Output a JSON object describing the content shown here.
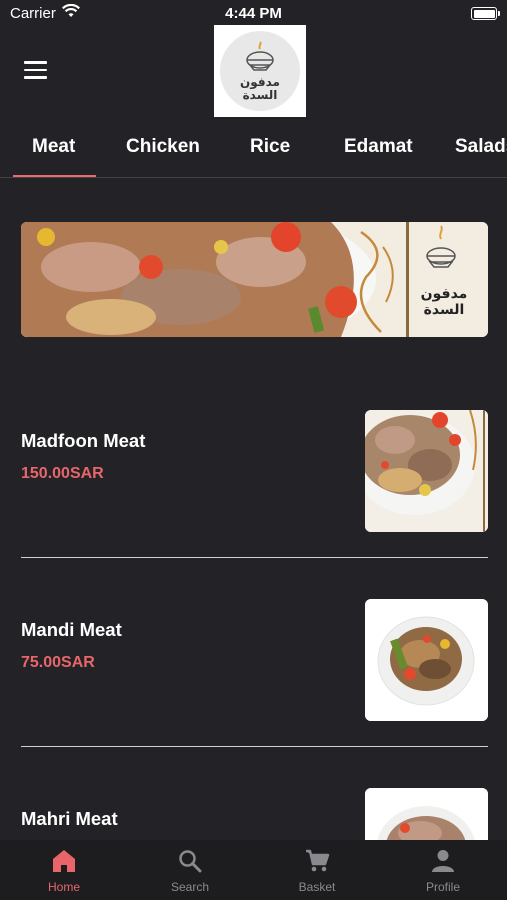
{
  "status_bar": {
    "carrier": "Carrier",
    "time": "4:44 PM"
  },
  "header": {
    "logo_text_line1": "مدفون",
    "logo_text_line2": "السدة"
  },
  "tabs": [
    {
      "label": "Meat",
      "active": true
    },
    {
      "label": "Chicken"
    },
    {
      "label": "Rice"
    },
    {
      "label": "Edamat"
    },
    {
      "label": "Salads"
    }
  ],
  "banner": {
    "logo_text_line1": "مدفون",
    "logo_text_line2": "السدة"
  },
  "items": [
    {
      "name": "Madfoon Meat",
      "price": "150.00SAR"
    },
    {
      "name": "Mandi Meat",
      "price": "75.00SAR"
    },
    {
      "name": "Mahri Meat",
      "price": ""
    }
  ],
  "bottom_nav": [
    {
      "label": "Home",
      "icon": "home-icon",
      "active": true
    },
    {
      "label": "Search",
      "icon": "search-icon"
    },
    {
      "label": "Basket",
      "icon": "cart-icon"
    },
    {
      "label": "Profile",
      "icon": "profile-icon"
    }
  ],
  "colors": {
    "accent": "#e8666a",
    "background": "#232327",
    "nav_background": "#1d1d20"
  }
}
